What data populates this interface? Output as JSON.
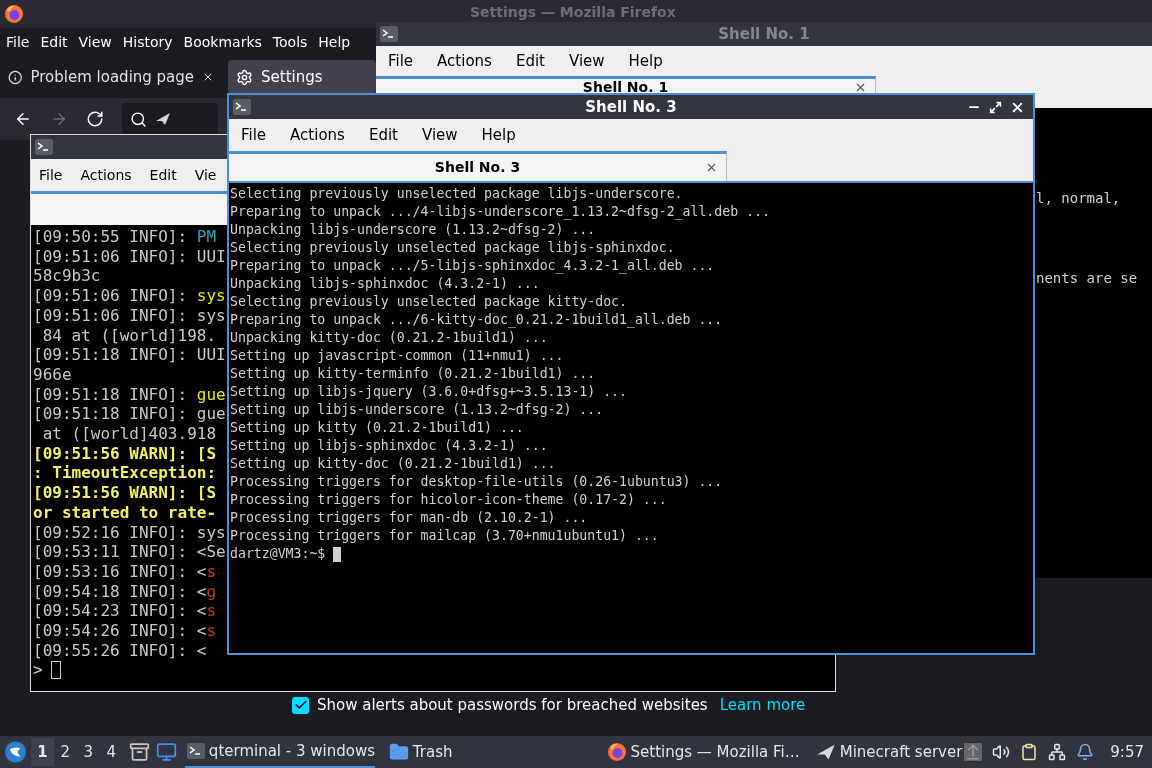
{
  "firefox": {
    "title": "Settings — Mozilla Firefox",
    "menu": [
      "File",
      "Edit",
      "View",
      "History",
      "Bookmarks",
      "Tools",
      "Help"
    ],
    "tabs": [
      {
        "label": "Problem loading page",
        "kind": "error",
        "selected": false
      },
      {
        "label": "Settings",
        "kind": "settings",
        "selected": true
      }
    ],
    "nav": [
      {
        "kind": "back",
        "disabled": false
      },
      {
        "kind": "forward",
        "disabled": true
      },
      {
        "kind": "reload",
        "disabled": false
      }
    ],
    "content": {
      "checkbox": {
        "label": "Show alerts about passwords for breached websites",
        "checked": true
      },
      "link": "Learn more"
    }
  },
  "shell_1": {
    "title": "Shell No. 1",
    "active": false,
    "menu": [
      "File",
      "Actions",
      "Edit",
      "View",
      "Help"
    ],
    "tab": "Shell No. 1",
    "lines": [
      "l, normal,",
      "nents are se"
    ]
  },
  "shell_2": {
    "menu": [
      "File",
      "Actions",
      "Edit",
      "Vie"
    ],
    "lines": [
      [
        {
          "text": "[09:50:55 INFO]: ",
          "kind": "plain"
        },
        {
          "text": "PM",
          "kind": "cyan"
        }
      ],
      [
        {
          "text": "[09:51:06 INFO]: UUI",
          "kind": "plain"
        }
      ],
      [
        {
          "text": "58c9b3c",
          "kind": "plain"
        }
      ],
      [
        {
          "text": "[09:51:06 INFO]: ",
          "kind": "plain"
        },
        {
          "text": "sys",
          "kind": "yellow"
        }
      ],
      [
        {
          "text": "[09:51:06 INFO]: sys",
          "kind": "plain"
        }
      ],
      [
        {
          "text": " 84 at ([world]198.",
          "kind": "plain"
        }
      ],
      [
        {
          "text": "[09:51:18 INFO]: UUI",
          "kind": "plain"
        }
      ],
      [
        {
          "text": "966e",
          "kind": "plain"
        }
      ],
      [
        {
          "text": "[09:51:18 INFO]: ",
          "kind": "plain"
        },
        {
          "text": "gue",
          "kind": "yellow"
        }
      ],
      [
        {
          "text": "[09:51:18 INFO]: gue",
          "kind": "plain"
        }
      ],
      [
        {
          "text": " at ([world]403.918",
          "kind": "plain"
        }
      ],
      [
        {
          "text": "[09:51:56 WARN]: [S",
          "kind": "warn"
        }
      ],
      [
        {
          "text": ": TimeoutException:",
          "kind": "warn"
        }
      ],
      [
        {
          "text": "[09:51:56 WARN]: [S",
          "kind": "warn"
        }
      ],
      [
        {
          "text": "or started to rate-",
          "kind": "warn"
        }
      ],
      [
        {
          "text": "[09:52:16 INFO]: sys",
          "kind": "plain"
        }
      ],
      [
        {
          "text": "[09:53:11 INFO]: <Se",
          "kind": "plain"
        }
      ],
      [
        {
          "text": "[09:53:16 INFO]: <",
          "kind": "plain"
        },
        {
          "text": "s",
          "kind": "red"
        }
      ],
      [
        {
          "text": "[09:54:18 INFO]: <",
          "kind": "plain"
        },
        {
          "text": "g",
          "kind": "red"
        }
      ],
      [
        {
          "text": "[09:54:23 INFO]: <",
          "kind": "plain"
        },
        {
          "text": "s",
          "kind": "red"
        }
      ],
      [
        {
          "text": "[09:54:26 INFO]: <",
          "kind": "plain"
        },
        {
          "text": "s",
          "kind": "red"
        }
      ],
      [
        {
          "text": "[09:55:26 INFO]: <",
          "kind": "plain"
        }
      ]
    ],
    "prompt": ">"
  },
  "shell_3": {
    "title": "Shell No. 3",
    "active": true,
    "menu": [
      "File",
      "Actions",
      "Edit",
      "View",
      "Help"
    ],
    "tab": "Shell No. 3",
    "lines": [
      "Selecting previously unselected package libjs-underscore.",
      "Preparing to unpack .../4-libjs-underscore_1.13.2~dfsg-2_all.deb ...",
      "Unpacking libjs-underscore (1.13.2~dfsg-2) ...",
      "Selecting previously unselected package libjs-sphinxdoc.",
      "Preparing to unpack .../5-libjs-sphinxdoc_4.3.2-1_all.deb ...",
      "Unpacking libjs-sphinxdoc (4.3.2-1) ...",
      "Selecting previously unselected package kitty-doc.",
      "Preparing to unpack .../6-kitty-doc_0.21.2-1build1_all.deb ...",
      "Unpacking kitty-doc (0.21.2-1build1) ...",
      "Setting up javascript-common (11+nmu1) ...",
      "Setting up kitty-terminfo (0.21.2-1build1) ...",
      "Setting up libjs-jquery (3.6.0+dfsg+~3.5.13-1) ...",
      "Setting up libjs-underscore (1.13.2~dfsg-2) ...",
      "Setting up kitty (0.21.2-1build1) ...",
      "Setting up libjs-sphinxdoc (4.3.2-1) ...",
      "Setting up kitty-doc (0.21.2-1build1) ...",
      "Processing triggers for desktop-file-utils (0.26-1ubuntu3) ...",
      "Processing triggers for hicolor-icon-theme (0.17-2) ...",
      "Processing triggers for man-db (2.10.2-1) ...",
      "Processing triggers for mailcap (3.70+nmu1ubuntu1) ..."
    ],
    "prompt": "dartz@VM3:~$"
  },
  "taskbar": {
    "desktops": [
      {
        "label": "1",
        "selected": true
      },
      {
        "label": "2",
        "selected": false
      },
      {
        "label": "3",
        "selected": false
      },
      {
        "label": "4",
        "selected": false
      }
    ],
    "tasks": [
      {
        "label": "qterminal - 3 windows",
        "kind": "terminal",
        "selected": true
      },
      {
        "label": "Trash",
        "kind": "folder",
        "selected": false
      },
      {
        "label": "Settings — Mozilla Fi…",
        "kind": "browser",
        "selected": false
      },
      {
        "label": "Minecraft server",
        "kind": "server",
        "selected": false
      }
    ],
    "clock": "9:57"
  }
}
